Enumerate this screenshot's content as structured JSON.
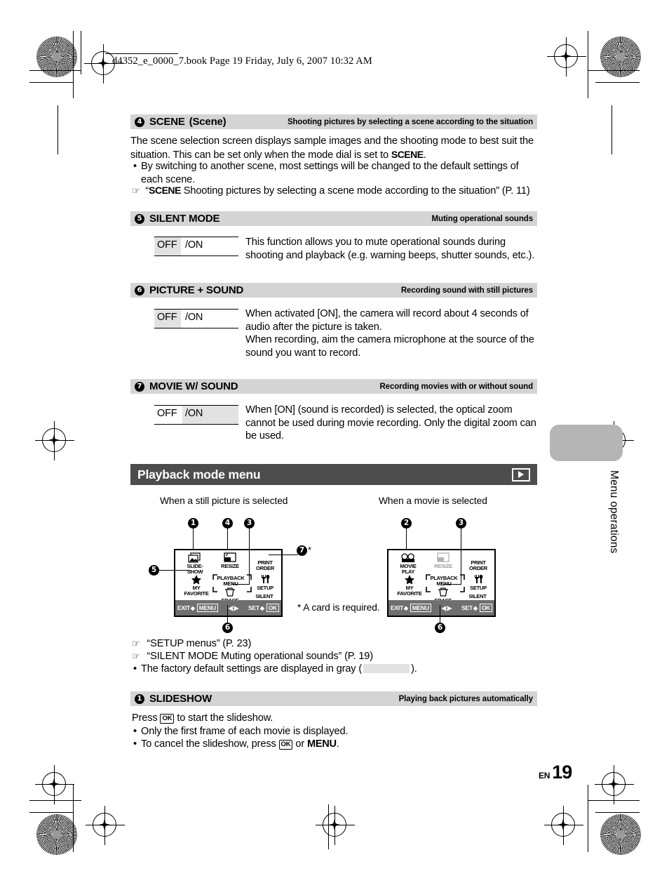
{
  "header": {
    "book_line": "d4352_e_0000_7.book  Page 19  Friday, July 6, 2007  10:32 AM"
  },
  "sections": [
    {
      "number": "4",
      "title": "SCENE",
      "title_suffix": "(Scene)",
      "subtitle": "Shooting pictures by selecting a scene according to the situation",
      "paragraph": "The scene selection screen displays sample images and the shooting mode to best suit the situation. This can be set only when the mode dial is set to ",
      "paragraph_scene": "SCENE",
      "paragraph_end": ".",
      "bullet": "By switching to another scene, most settings will be changed to the default settings of each scene.",
      "ref_scene": "SCENE",
      "ref_text": " Shooting pictures by selecting a scene mode according to the situation” (P. 11)",
      "ref_open": "“"
    },
    {
      "number": "5",
      "title": "SILENT MODE",
      "subtitle": "Muting operational sounds",
      "value_off": "OFF",
      "value_on": "/ON",
      "highlight": "off",
      "desc": "This function allows you to mute operational sounds during shooting and playback (e.g. warning beeps, shutter sounds, etc.)."
    },
    {
      "number": "6",
      "title": "PICTURE + SOUND",
      "subtitle": "Recording sound with still pictures",
      "value_off": "OFF",
      "value_on": "/ON",
      "highlight": "off",
      "desc": "When activated [ON], the camera will record about 4 seconds of audio after the picture is taken.",
      "desc2": "When recording, aim the camera microphone at the source of the sound you want to record."
    },
    {
      "number": "7",
      "title": "MOVIE W/ SOUND",
      "subtitle": "Recording movies with or without sound",
      "value_off": "OFF",
      "value_on": "/ON",
      "highlight": "on",
      "desc": "When [ON] (sound is recorded) is selected, the optical zoom cannot be used during movie recording. Only the digital zoom can be used."
    }
  ],
  "playback": {
    "banner_title": "Playback mode menu",
    "banner_icon": "playback-triangle-icon",
    "caption_left": "When a still picture is selected",
    "caption_right": "When a movie is selected",
    "footnote": "* A card is required.",
    "screen_left": {
      "items": [
        {
          "label": "SLIDE-\nSHOW",
          "icon": "slideshow-icon",
          "dim": false
        },
        {
          "label": "RESIZE",
          "icon": "resize-icon",
          "dim": false
        },
        {
          "label": "PRINT\nORDER",
          "icon": "print-order-icon",
          "dim": false
        },
        {
          "label": "MY\nFAVORITE",
          "icon": "star-icon",
          "dim": false
        },
        {
          "label": "PLAYBACK\nMENU",
          "icon": "playback-menu-label",
          "dim": false
        },
        {
          "label": "SETUP",
          "icon": "wrench-icon",
          "dim": false
        },
        {
          "label": "ERASE",
          "icon": "erase-icon",
          "dim": false
        },
        {
          "label": "SILENT\nMODE",
          "icon": "silent-mode-icon",
          "dim": false
        }
      ],
      "bottom": {
        "exit": "EXIT",
        "exit_key": "MENU",
        "set": "SET",
        "set_key": "OK"
      }
    },
    "screen_right": {
      "items": [
        {
          "label": "MOVIE\nPLAY",
          "icon": "movie-play-icon",
          "dim": false
        },
        {
          "label": "RESIZE",
          "icon": "resize-icon",
          "dim": true
        },
        {
          "label": "PRINT\nORDER",
          "icon": "print-order-icon",
          "dim": true
        },
        {
          "label": "MY\nFAVORITE",
          "icon": "star-icon",
          "dim": false
        },
        {
          "label": "PLAYBACK\nMENU",
          "icon": "playback-menu-label",
          "dim": false
        },
        {
          "label": "SETUP",
          "icon": "wrench-icon",
          "dim": false
        },
        {
          "label": "ERASE",
          "icon": "erase-icon",
          "dim": false
        },
        {
          "label": "SILENT\nMODE",
          "icon": "silent-mode-icon",
          "dim": false
        }
      ],
      "bottom": {
        "exit": "EXIT",
        "exit_key": "MENU",
        "set": "SET",
        "set_key": "OK"
      }
    },
    "callouts_left": [
      "1",
      "4",
      "3",
      "7",
      "5",
      "6"
    ],
    "callouts_right": [
      "2",
      "3",
      "6"
    ],
    "callout7_star": "*"
  },
  "refs": {
    "ref1": "“SETUP menus” (P. 23)",
    "ref2": "“SILENT MODE Muting operational sounds” (P. 19)",
    "note_pre": "The factory default settings are displayed in gray (",
    "note_post": ")."
  },
  "slideshow": {
    "number": "1",
    "title": "SLIDESHOW",
    "subtitle": "Playing back pictures automatically",
    "line1_pre": "Press ",
    "line1_key": "OK",
    "line1_post": " to start the slideshow.",
    "bullet1": "Only the first frame of each movie is displayed.",
    "bullet2_pre": "To cancel the slideshow, press ",
    "bullet2_key": "OK",
    "bullet2_mid": " or ",
    "bullet2_menu": "MENU",
    "bullet2_post": "."
  },
  "sidetab": {
    "label": "Menu operations"
  },
  "page": {
    "lang": "EN",
    "number": "19"
  }
}
